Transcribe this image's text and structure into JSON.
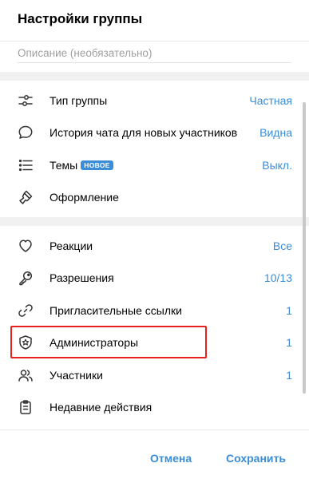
{
  "dialog": {
    "title": "Настройки группы",
    "description_placeholder": "Описание (необязательно)"
  },
  "sections": [
    {
      "items": [
        {
          "icon": "sliders-icon",
          "label": "Тип группы",
          "value": "Частная"
        },
        {
          "icon": "chat-bubble-icon",
          "label": "История чата для новых участников",
          "value": "Видна"
        },
        {
          "icon": "list-icon",
          "label": "Темы",
          "badge": "НОВОЕ",
          "value": "Выкл."
        },
        {
          "icon": "brush-icon",
          "label": "Оформление",
          "value": ""
        }
      ]
    },
    {
      "items": [
        {
          "icon": "heart-icon",
          "label": "Реакции",
          "value": "Все"
        },
        {
          "icon": "key-icon",
          "label": "Разрешения",
          "value": "10/13"
        },
        {
          "icon": "link-icon",
          "label": "Пригласительные ссылки",
          "value": "1"
        },
        {
          "icon": "shield-star-icon",
          "label": "Администраторы",
          "value": "1"
        },
        {
          "icon": "people-icon",
          "label": "Участники",
          "value": "1"
        },
        {
          "icon": "clipboard-icon",
          "label": "Недавние действия",
          "value": ""
        }
      ]
    }
  ],
  "footer": {
    "cancel_label": "Отмена",
    "save_label": "Сохранить"
  },
  "colors": {
    "accent": "#3a8dd6",
    "highlight": "#e8201e",
    "section_gap": "#f1f1f1"
  }
}
